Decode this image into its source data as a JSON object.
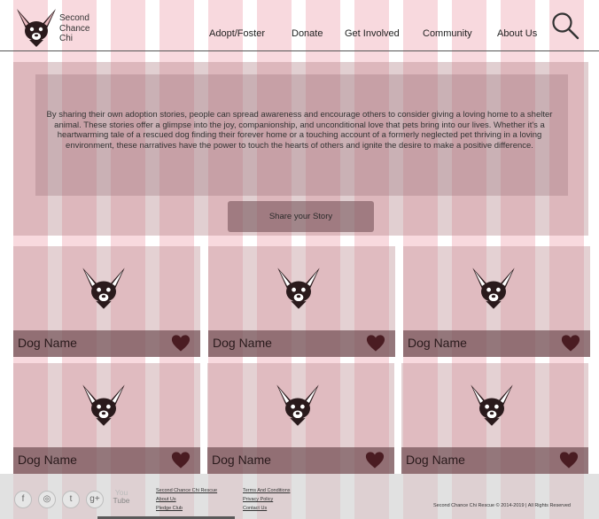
{
  "header": {
    "logo_lines": [
      "Second",
      "Chance",
      "Chi"
    ],
    "nav": [
      "Adopt/Foster",
      "Donate",
      "Get Involved",
      "Community",
      "About Us"
    ],
    "search_icon": "search-icon"
  },
  "intro": {
    "text": "By sharing their own adoption stories, people can spread awareness and encourage others to consider giving a loving home to a shelter animal. These stories offer a glimpse into the joy, companionship, and unconditional love that pets bring into our lives. Whether it's a heartwarming tale of a rescued dog finding their forever home or a touching account of a formerly neglected pet thriving in a loving environment, these narratives have the power to touch the hearts of others and ignite the desire to make a positive difference.",
    "button_label": "Share your Story"
  },
  "cards": [
    {
      "name": "Dog Name",
      "icon": "heart-icon"
    },
    {
      "name": "Dog Name",
      "icon": "heart-icon"
    },
    {
      "name": "Dog Name",
      "icon": "heart-icon"
    },
    {
      "name": "Dog Name",
      "icon": "heart-icon"
    },
    {
      "name": "Dog Name",
      "icon": "heart-icon"
    },
    {
      "name": "Dog Name",
      "icon": "heart-icon"
    }
  ],
  "footer": {
    "social": [
      "f",
      "◎",
      "t",
      "g+"
    ],
    "youtube_top": "You",
    "youtube_bottom": "Tube",
    "links_col1": [
      "Second Chance Chi Rescue",
      "About Us",
      "Pledge Club"
    ],
    "links_col2": [
      "Terms And Conditions",
      "Privacy Policy",
      "Contact Us"
    ],
    "copyright": "Second Chance Chi Rescue © 2014-2019 | All Rights Reserved"
  },
  "colors": {
    "grid_stripe": "#e88291",
    "card_footer": "#69464b",
    "heart": "#4a1c22"
  }
}
